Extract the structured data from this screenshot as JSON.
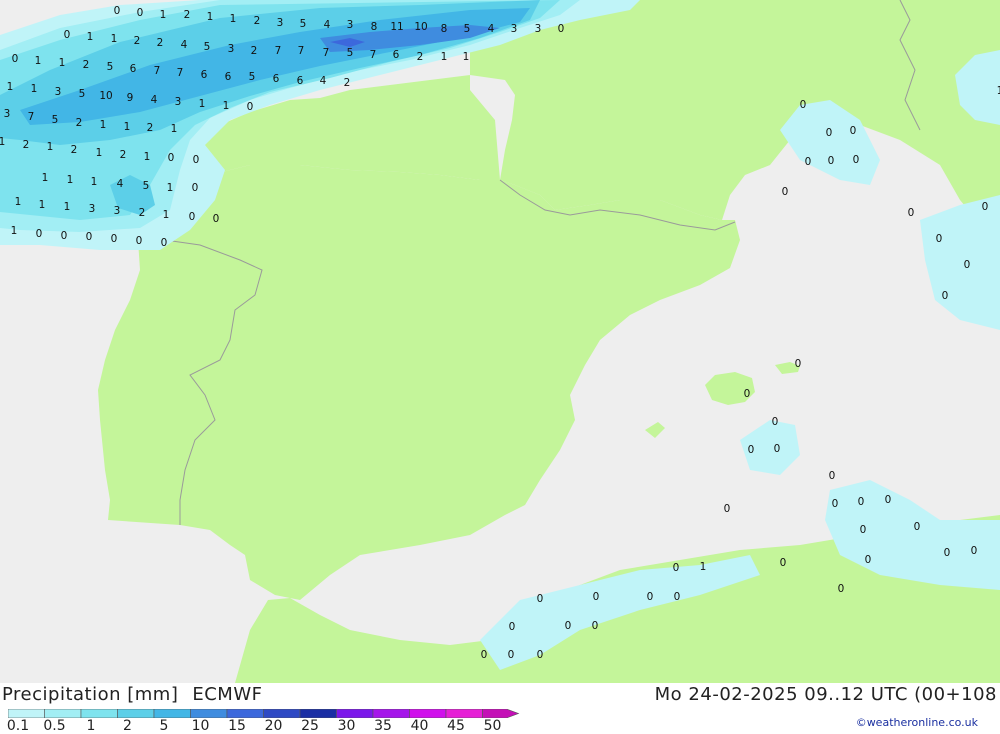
{
  "header": {
    "title": "Precipitation [mm]",
    "source": "ECMWF",
    "datetime": "Mo 24-02-2025 09..12 UTC (00+108"
  },
  "legend": {
    "steps": [
      "0.1",
      "0.5",
      "1",
      "2",
      "5",
      "10",
      "15",
      "20",
      "25",
      "30",
      "35",
      "40",
      "45",
      "50"
    ],
    "colors": [
      "#c0f4f8",
      "#a2eef4",
      "#7ee3ee",
      "#5ccfe8",
      "#42b6e6",
      "#3f8cdf",
      "#3c68dc",
      "#2e49c4",
      "#1a2ea4",
      "#7b17ea",
      "#a515ea",
      "#d010ec",
      "#e620d6",
      "#c410b6"
    ]
  },
  "credit": "©weatheronline.co.uk",
  "map": {
    "land_color": "#c4f59a",
    "sea_color": "#eeeeee",
    "values": [
      "0",
      "0",
      "1",
      "2",
      "1",
      "1",
      "2",
      "3",
      "5",
      "4",
      "3",
      "8",
      "11",
      "10",
      "8",
      "5",
      "4",
      "3",
      "3",
      "0",
      "0",
      "1",
      "1",
      "2",
      "2",
      "4",
      "5",
      "3",
      "2",
      "7",
      "7",
      "7",
      "5",
      "7",
      "6",
      "2",
      "1",
      "1",
      "0",
      "1",
      "1",
      "2",
      "5",
      "6",
      "7",
      "7",
      "6",
      "6",
      "5",
      "6",
      "6",
      "4",
      "2",
      "1",
      "1",
      "3",
      "5",
      "10",
      "9",
      "4",
      "3",
      "1",
      "1",
      "0",
      "3",
      "7",
      "5",
      "2",
      "1",
      "1",
      "2",
      "1",
      "1",
      "2",
      "1",
      "2",
      "1",
      "2",
      "1",
      "0",
      "0",
      "1",
      "1",
      "1",
      "4",
      "5",
      "1",
      "0",
      "1",
      "1",
      "1",
      "3",
      "3",
      "2",
      "1",
      "0",
      "0",
      "1",
      "0",
      "0",
      "0",
      "0",
      "0",
      "0",
      "0",
      "0",
      "0",
      "0",
      "0",
      "0",
      "0",
      "0",
      "0",
      "1",
      "0",
      "0",
      "0",
      "0",
      "0",
      "0",
      "0",
      "0",
      "0",
      "0",
      "0",
      "0",
      "0",
      "0",
      "0",
      "0",
      "0",
      "0",
      "0",
      "0",
      "0",
      "1",
      "0",
      "0",
      "0",
      "0",
      "0",
      "0",
      "0",
      "0",
      "0",
      "0"
    ]
  }
}
